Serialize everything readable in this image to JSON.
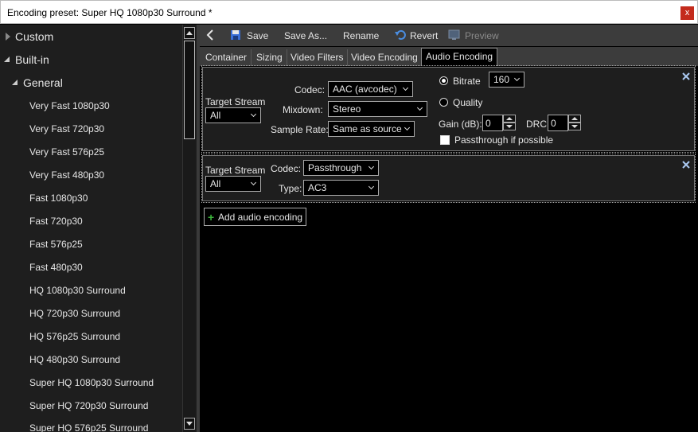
{
  "window": {
    "title": "Encoding preset: Super HQ 1080p30 Surround *",
    "close_glyph": "x"
  },
  "sidebar": {
    "custom_label": "Custom",
    "builtin_label": "Built-in",
    "general_label": "General",
    "presets": [
      "Very Fast 1080p30",
      "Very Fast 720p30",
      "Very Fast 576p25",
      "Very Fast 480p30",
      "Fast 1080p30",
      "Fast 720p30",
      "Fast 576p25",
      "Fast 480p30",
      "HQ 1080p30 Surround",
      "HQ 720p30 Surround",
      "HQ 576p25 Surround",
      "HQ 480p30 Surround",
      "Super HQ 1080p30 Surround",
      "Super HQ 720p30 Surround",
      "Super HQ 576p25 Surround"
    ]
  },
  "toolbar": {
    "save": "Save",
    "save_as": "Save As...",
    "rename": "Rename",
    "revert": "Revert",
    "preview": "Preview"
  },
  "tabs": [
    "Container",
    "Sizing",
    "Video Filters",
    "Video Encoding",
    "Audio Encoding"
  ],
  "audio": {
    "encodings": [
      {
        "target_stream_label": "Target Stream",
        "target_stream_value": "All",
        "codec_label": "Codec:",
        "codec_value": "AAC (avcodec)",
        "mixdown_label": "Mixdown:",
        "mixdown_value": "Stereo",
        "sample_rate_label": "Sample Rate:",
        "sample_rate_value": "Same as source",
        "bitrate_label": "Bitrate",
        "bitrate_value": "160",
        "quality_label": "Quality",
        "gain_label": "Gain (dB):",
        "gain_value": "0",
        "drc_label": "DRC:",
        "drc_value": "0",
        "passthrough_label": "Passthrough if possible"
      },
      {
        "target_stream_label": "Target Stream",
        "target_stream_value": "All",
        "codec_label": "Codec:",
        "codec_value": "Passthrough",
        "type_label": "Type:",
        "type_value": "AC3"
      }
    ],
    "add_label": "Add audio encoding"
  },
  "colors": {
    "accent_green": "#3cb43c",
    "close_red": "#c42b1c",
    "save_icon_blue": "#3a6fd8"
  }
}
